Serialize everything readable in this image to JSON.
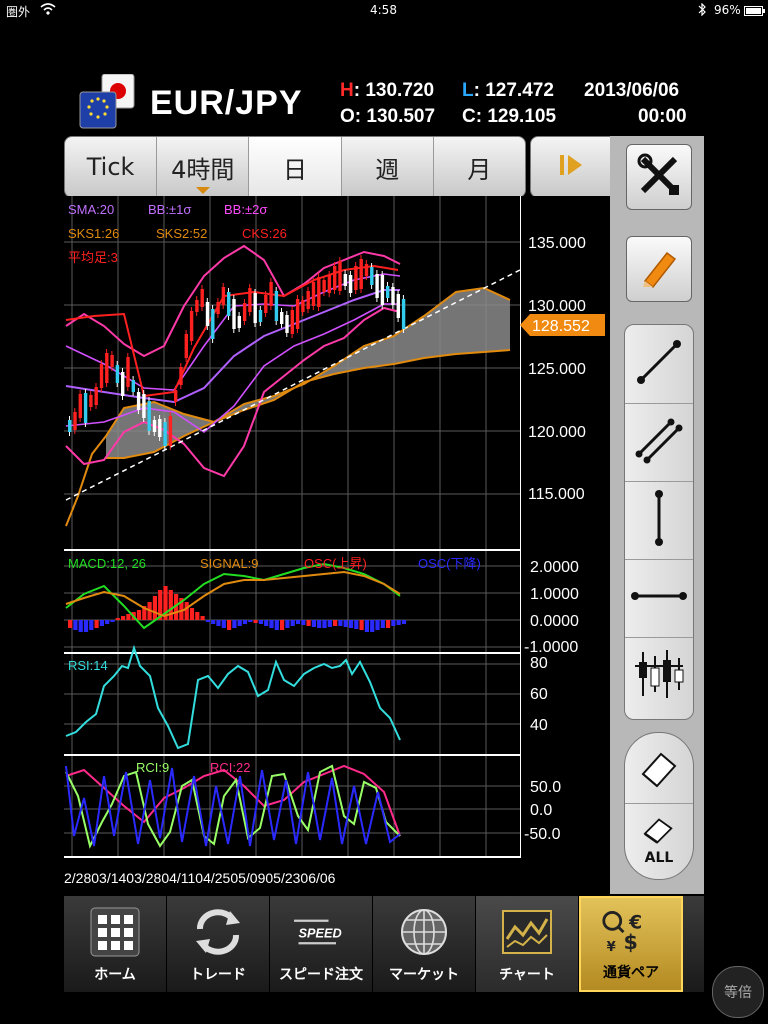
{
  "status": {
    "carrier": "圏外",
    "time": "4:58",
    "battery": "96%"
  },
  "header": {
    "pair": "EUR/JPY",
    "high_label": "H",
    "high": ": 130.720",
    "low_label": "L",
    "low": ": 127.472",
    "open_label": "O",
    "open": ": 130.507",
    "close_label": "C",
    "close": ": 129.105",
    "date": "2013/06/06",
    "time": "00:00"
  },
  "tabs": [
    "Tick",
    "4時間",
    "日",
    "週",
    "月"
  ],
  "active_tab": "日",
  "price_axis": [
    "135.000",
    "130.000",
    "125.000",
    "120.000",
    "115.000"
  ],
  "current_price": "128.552",
  "legends": {
    "main": [
      {
        "text": "SMA:20",
        "color": "#c070ff"
      },
      {
        "text": "BB:±1σ",
        "color": "#c070ff"
      },
      {
        "text": "BB:±2σ",
        "color": "#ff4aff"
      },
      {
        "text": "SKS1:26",
        "color": "#e08a10"
      },
      {
        "text": "SKS2:52",
        "color": "#e08a10"
      },
      {
        "text": "CKS:26",
        "color": "#ff2020"
      },
      {
        "text": "平均足:3",
        "color": "#ff2020"
      }
    ],
    "macd": [
      {
        "text": "MACD:12, 26",
        "color": "#22dd22"
      },
      {
        "text": "SIGNAL:9",
        "color": "#e08a10"
      },
      {
        "text": "OSC(上昇)",
        "color": "#ff2020"
      },
      {
        "text": "OSC(下降)",
        "color": "#2a2aff"
      }
    ],
    "rsi": [
      {
        "text": "RSI:14",
        "color": "#33dddd"
      }
    ],
    "rci": [
      {
        "text": "RCI:9",
        "color": "#99ff66"
      },
      {
        "text": "RCI:22",
        "color": "#ff2a8a"
      }
    ]
  },
  "macd_axis": [
    "2.0000",
    "1.0000",
    "0.0000",
    "-1.0000"
  ],
  "rsi_axis": [
    "80",
    "60",
    "40"
  ],
  "rci_axis": [
    "50.0",
    "0.0",
    "-50.0"
  ],
  "dates_text": "2/2803/1403/2804/1104/2505/0905/2306/06",
  "bottom_tabs": [
    "ホーム",
    "トレード",
    "スピード注文",
    "マーケット",
    "チャート",
    "通貨ペア"
  ],
  "speed_icon_text": "SPEED",
  "zoom_label": "等倍",
  "colors": {
    "bull": "#ff2020",
    "bear": "#ffffff",
    "cloud": "#8a8a8a",
    "accent": "#f08a10"
  }
}
